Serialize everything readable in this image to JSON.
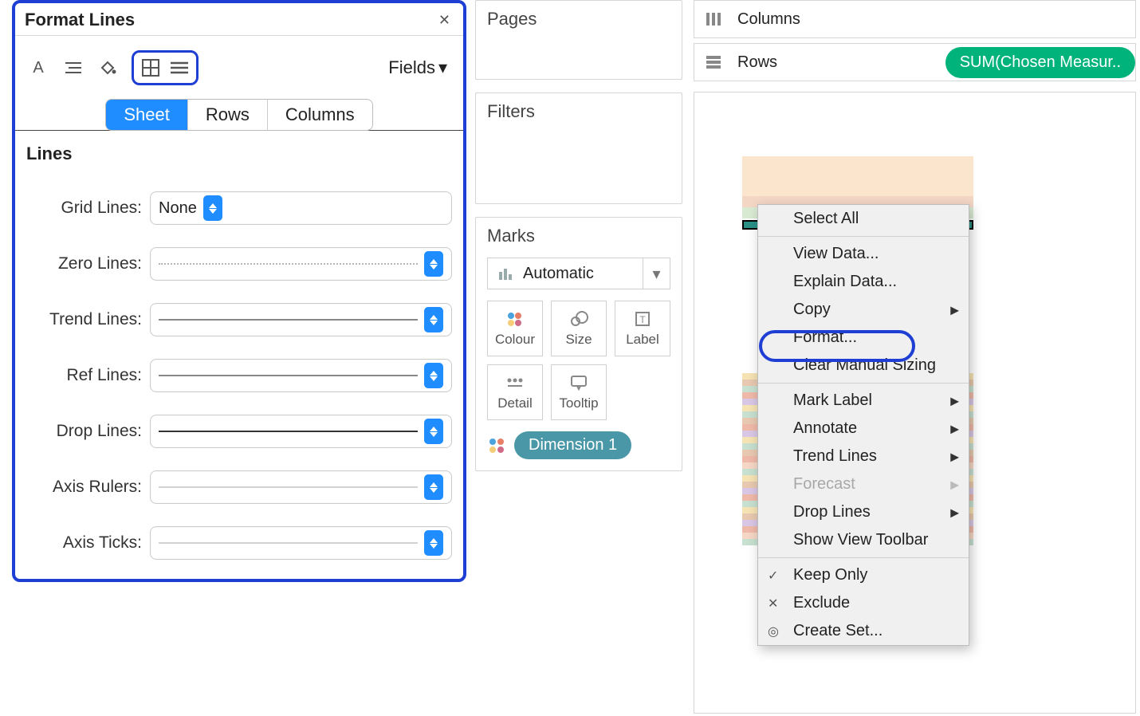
{
  "format_panel": {
    "title": "Format Lines",
    "fields_label": "Fields",
    "tabs": {
      "sheet": "Sheet",
      "rows": "Rows",
      "columns": "Columns"
    },
    "section_heading": "Lines",
    "rows": {
      "grid": {
        "label": "Grid Lines:",
        "value": "None"
      },
      "zero": {
        "label": "Zero Lines:"
      },
      "trend": {
        "label": "Trend Lines:"
      },
      "ref": {
        "label": "Ref Lines:"
      },
      "drop": {
        "label": "Drop Lines:"
      },
      "rulers": {
        "label": "Axis Rulers:"
      },
      "ticks": {
        "label": "Axis Ticks:"
      }
    }
  },
  "shelves": {
    "pages": "Pages",
    "filters": "Filters",
    "marks": "Marks",
    "mark_type": "Automatic",
    "mark_cells": {
      "colour": "Colour",
      "size": "Size",
      "label": "Label",
      "detail": "Detail",
      "tooltip": "Tooltip"
    },
    "dimension_pill": "Dimension 1"
  },
  "right": {
    "columns_label": "Columns",
    "rows_label": "Rows",
    "rows_pill": "SUM(Chosen Measur.."
  },
  "context_menu": {
    "select_all": "Select All",
    "view_data": "View Data...",
    "explain_data": "Explain Data...",
    "copy": "Copy",
    "format": "Format...",
    "clear_sizing": "Clear Manual Sizing",
    "mark_label": "Mark Label",
    "annotate": "Annotate",
    "trend_lines": "Trend Lines",
    "forecast": "Forecast",
    "drop_lines": "Drop Lines",
    "show_toolbar": "Show View Toolbar",
    "keep_only": "Keep Only",
    "exclude": "Exclude",
    "create_set": "Create Set..."
  }
}
